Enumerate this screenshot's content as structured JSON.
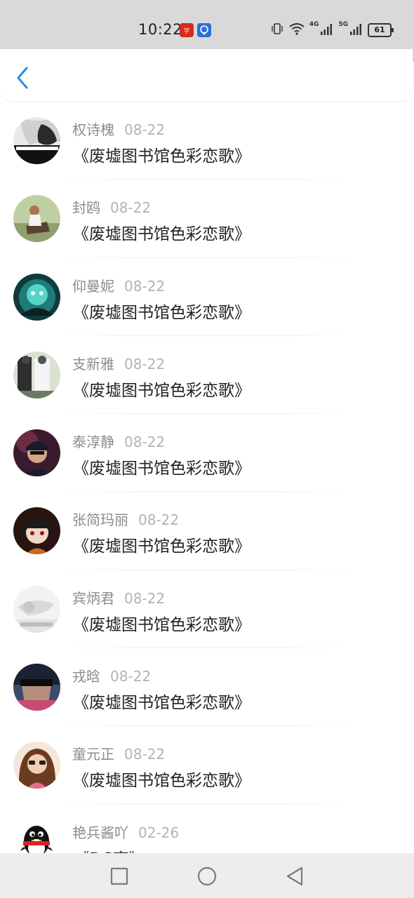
{
  "status_bar": {
    "time": "10:22",
    "network_1": "4G",
    "network_2": "5G",
    "battery": "61"
  },
  "header": {
    "back_icon": "chevron-left-icon",
    "accent_color": "#2b8de6"
  },
  "list": {
    "items": [
      {
        "name": "权诗槐",
        "date": "08-22",
        "title": "《废墟图书馆色彩恋歌》",
        "avatar": "avatar-1"
      },
      {
        "name": "封鸥",
        "date": "08-22",
        "title": "《废墟图书馆色彩恋歌》",
        "avatar": "avatar-2"
      },
      {
        "name": "仰曼妮",
        "date": "08-22",
        "title": "《废墟图书馆色彩恋歌》",
        "avatar": "avatar-3"
      },
      {
        "name": "支新雅",
        "date": "08-22",
        "title": "《废墟图书馆色彩恋歌》",
        "avatar": "avatar-4"
      },
      {
        "name": "泰淳静",
        "date": "08-22",
        "title": "《废墟图书馆色彩恋歌》",
        "avatar": "avatar-5"
      },
      {
        "name": "张简玛丽",
        "date": "08-22",
        "title": "《废墟图书馆色彩恋歌》",
        "avatar": "avatar-6"
      },
      {
        "name": "宾炳君",
        "date": "08-22",
        "title": "《废墟图书馆色彩恋歌》",
        "avatar": "avatar-7"
      },
      {
        "name": "戎晗",
        "date": "08-22",
        "title": "《废墟图书馆色彩恋歌》",
        "avatar": "avatar-8"
      },
      {
        "name": "童元正",
        "date": "08-22",
        "title": "《废墟图书馆色彩恋歌》",
        "avatar": "avatar-9"
      },
      {
        "name": "艳兵酱吖",
        "date": "02-26",
        "title": "《DC齐》",
        "avatar": "qq-penguin-avatar"
      }
    ]
  },
  "nav_bar": {
    "recents_icon": "square-icon",
    "home_icon": "circle-icon",
    "back_icon": "triangle-back-icon"
  }
}
